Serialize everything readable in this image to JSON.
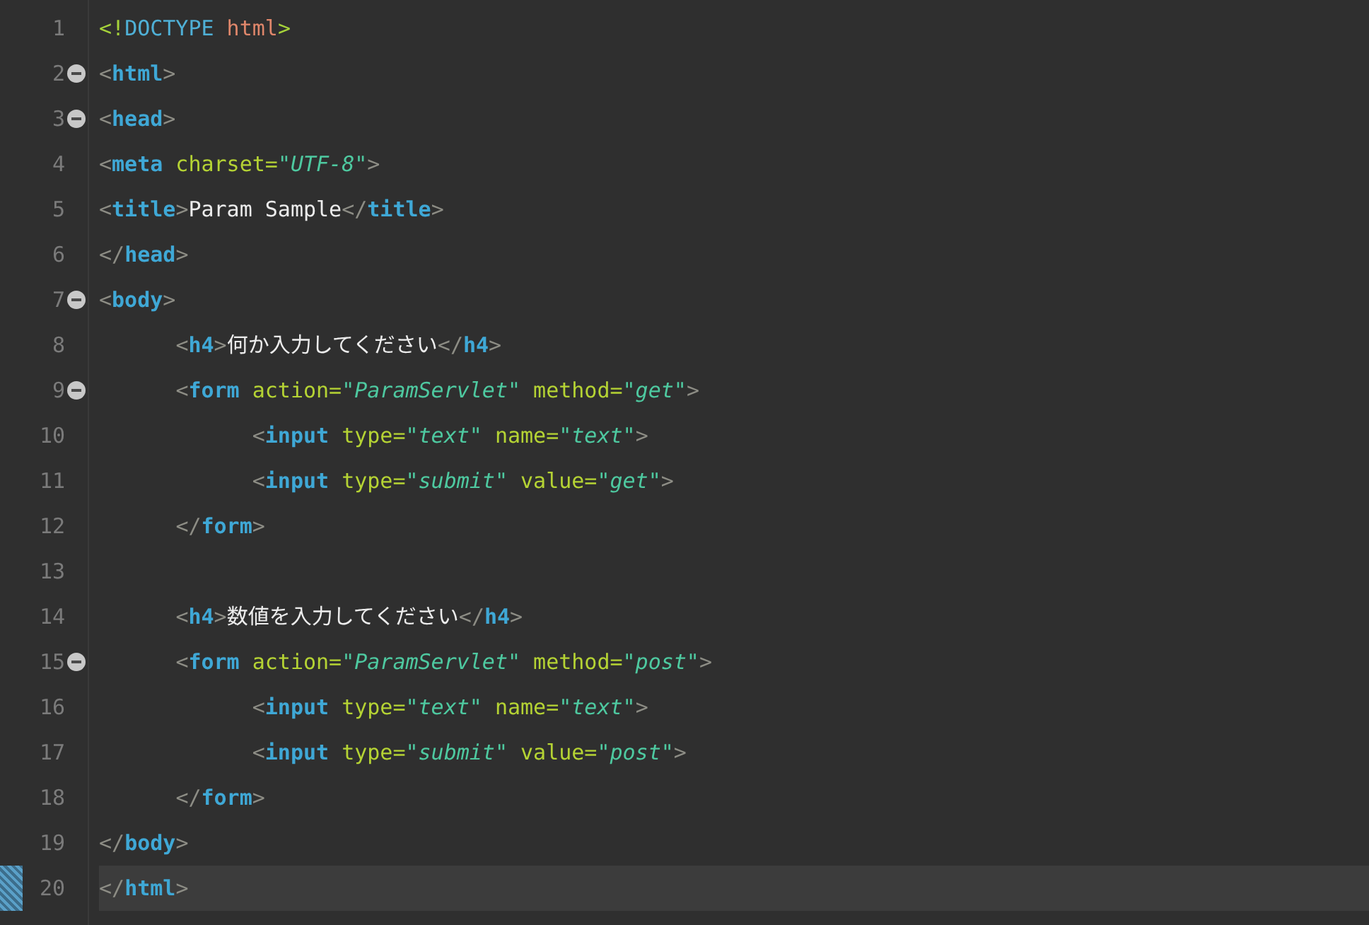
{
  "editor": {
    "lines": [
      {
        "number": "1",
        "foldable": false,
        "marked": false,
        "current": false,
        "tokens": [
          {
            "kind": "doctype-punct",
            "text": "<!"
          },
          {
            "kind": "doctype",
            "text": "DOCTYPE"
          },
          {
            "kind": "doctype-name",
            "text": " html"
          },
          {
            "kind": "doctype-punct",
            "text": ">"
          }
        ]
      },
      {
        "number": "2",
        "foldable": true,
        "marked": false,
        "current": false,
        "tokens": [
          {
            "kind": "bracket",
            "text": "<"
          },
          {
            "kind": "tag",
            "text": "html"
          },
          {
            "kind": "bracket",
            "text": ">"
          }
        ]
      },
      {
        "number": "3",
        "foldable": true,
        "marked": false,
        "current": false,
        "tokens": [
          {
            "kind": "bracket",
            "text": "<"
          },
          {
            "kind": "tag",
            "text": "head"
          },
          {
            "kind": "bracket",
            "text": ">"
          }
        ]
      },
      {
        "number": "4",
        "foldable": false,
        "marked": false,
        "current": false,
        "tokens": [
          {
            "kind": "bracket",
            "text": "<"
          },
          {
            "kind": "tag",
            "text": "meta"
          },
          {
            "kind": "attr",
            "text": " charset="
          },
          {
            "kind": "value",
            "text": "\"UTF-8\""
          },
          {
            "kind": "bracket",
            "text": ">"
          }
        ]
      },
      {
        "number": "5",
        "foldable": false,
        "marked": false,
        "current": false,
        "tokens": [
          {
            "kind": "bracket",
            "text": "<"
          },
          {
            "kind": "tag",
            "text": "title"
          },
          {
            "kind": "bracket",
            "text": ">"
          },
          {
            "kind": "text",
            "text": "Param Sample"
          },
          {
            "kind": "bracket",
            "text": "</"
          },
          {
            "kind": "tag",
            "text": "title"
          },
          {
            "kind": "bracket",
            "text": ">"
          }
        ]
      },
      {
        "number": "6",
        "foldable": false,
        "marked": false,
        "current": false,
        "tokens": [
          {
            "kind": "bracket",
            "text": "</"
          },
          {
            "kind": "tag",
            "text": "head"
          },
          {
            "kind": "bracket",
            "text": ">"
          }
        ]
      },
      {
        "number": "7",
        "foldable": true,
        "marked": false,
        "current": false,
        "tokens": [
          {
            "kind": "bracket",
            "text": "<"
          },
          {
            "kind": "tag",
            "text": "body"
          },
          {
            "kind": "bracket",
            "text": ">"
          }
        ]
      },
      {
        "number": "8",
        "foldable": false,
        "marked": false,
        "current": false,
        "tokens": [
          {
            "kind": "bracket",
            "text": "\t<"
          },
          {
            "kind": "tag",
            "text": "h4"
          },
          {
            "kind": "bracket",
            "text": ">"
          },
          {
            "kind": "text",
            "text": "何か入力してください"
          },
          {
            "kind": "bracket",
            "text": "</"
          },
          {
            "kind": "tag",
            "text": "h4"
          },
          {
            "kind": "bracket",
            "text": ">"
          }
        ]
      },
      {
        "number": "9",
        "foldable": true,
        "marked": false,
        "current": false,
        "tokens": [
          {
            "kind": "bracket",
            "text": "\t<"
          },
          {
            "kind": "tag",
            "text": "form"
          },
          {
            "kind": "attr",
            "text": " action="
          },
          {
            "kind": "value",
            "text": "\"ParamServlet\""
          },
          {
            "kind": "attr",
            "text": " method="
          },
          {
            "kind": "value",
            "text": "\"get\""
          },
          {
            "kind": "bracket",
            "text": ">"
          }
        ]
      },
      {
        "number": "10",
        "foldable": false,
        "marked": false,
        "current": false,
        "tokens": [
          {
            "kind": "bracket",
            "text": "\t\t<"
          },
          {
            "kind": "tag",
            "text": "input"
          },
          {
            "kind": "attr",
            "text": " type="
          },
          {
            "kind": "value",
            "text": "\"text\""
          },
          {
            "kind": "attr",
            "text": " name="
          },
          {
            "kind": "value",
            "text": "\"text\""
          },
          {
            "kind": "bracket",
            "text": ">"
          }
        ]
      },
      {
        "number": "11",
        "foldable": false,
        "marked": false,
        "current": false,
        "tokens": [
          {
            "kind": "bracket",
            "text": "\t\t<"
          },
          {
            "kind": "tag",
            "text": "input"
          },
          {
            "kind": "attr",
            "text": " type="
          },
          {
            "kind": "value",
            "text": "\"submit\""
          },
          {
            "kind": "attr",
            "text": " value="
          },
          {
            "kind": "value",
            "text": "\"get\""
          },
          {
            "kind": "bracket",
            "text": ">"
          }
        ]
      },
      {
        "number": "12",
        "foldable": false,
        "marked": false,
        "current": false,
        "tokens": [
          {
            "kind": "bracket",
            "text": "\t</"
          },
          {
            "kind": "tag",
            "text": "form"
          },
          {
            "kind": "bracket",
            "text": ">"
          }
        ]
      },
      {
        "number": "13",
        "foldable": false,
        "marked": false,
        "current": false
      },
      {
        "number": "14",
        "foldable": false,
        "marked": false,
        "current": false,
        "tokens": [
          {
            "kind": "bracket",
            "text": "\t<"
          },
          {
            "kind": "tag",
            "text": "h4"
          },
          {
            "kind": "bracket",
            "text": ">"
          },
          {
            "kind": "text",
            "text": "数値を入力してください"
          },
          {
            "kind": "bracket",
            "text": "</"
          },
          {
            "kind": "tag",
            "text": "h4"
          },
          {
            "kind": "bracket",
            "text": ">"
          }
        ]
      },
      {
        "number": "15",
        "foldable": true,
        "marked": false,
        "current": false,
        "tokens": [
          {
            "kind": "bracket",
            "text": "\t<"
          },
          {
            "kind": "tag",
            "text": "form"
          },
          {
            "kind": "attr",
            "text": " action="
          },
          {
            "kind": "value",
            "text": "\"ParamServlet\""
          },
          {
            "kind": "attr",
            "text": " method="
          },
          {
            "kind": "value",
            "text": "\"post\""
          },
          {
            "kind": "bracket",
            "text": ">"
          }
        ]
      },
      {
        "number": "16",
        "foldable": false,
        "marked": false,
        "current": false,
        "tokens": [
          {
            "kind": "bracket",
            "text": "\t\t<"
          },
          {
            "kind": "tag",
            "text": "input"
          },
          {
            "kind": "attr",
            "text": " type="
          },
          {
            "kind": "value",
            "text": "\"text\""
          },
          {
            "kind": "attr",
            "text": " name="
          },
          {
            "kind": "value",
            "text": "\"text\""
          },
          {
            "kind": "bracket",
            "text": ">"
          }
        ]
      },
      {
        "number": "17",
        "foldable": false,
        "marked": false,
        "current": false,
        "tokens": [
          {
            "kind": "bracket",
            "text": "\t\t<"
          },
          {
            "kind": "tag",
            "text": "input"
          },
          {
            "kind": "attr",
            "text": " type="
          },
          {
            "kind": "value",
            "text": "\"submit\""
          },
          {
            "kind": "attr",
            "text": " value="
          },
          {
            "kind": "value",
            "text": "\"post\""
          },
          {
            "kind": "bracket",
            "text": ">"
          }
        ]
      },
      {
        "number": "18",
        "foldable": false,
        "marked": false,
        "current": false,
        "tokens": [
          {
            "kind": "bracket",
            "text": "\t</"
          },
          {
            "kind": "tag",
            "text": "form"
          },
          {
            "kind": "bracket",
            "text": ">"
          }
        ]
      },
      {
        "number": "19",
        "foldable": false,
        "marked": false,
        "current": false,
        "tokens": [
          {
            "kind": "bracket",
            "text": "</"
          },
          {
            "kind": "tag",
            "text": "body"
          },
          {
            "kind": "bracket",
            "text": ">"
          }
        ]
      },
      {
        "number": "20",
        "foldable": false,
        "marked": true,
        "current": true,
        "tokens": [
          {
            "kind": "bracket",
            "text": "</"
          },
          {
            "kind": "tag",
            "text": "html"
          },
          {
            "kind": "bracket",
            "text": ">"
          }
        ]
      }
    ]
  }
}
